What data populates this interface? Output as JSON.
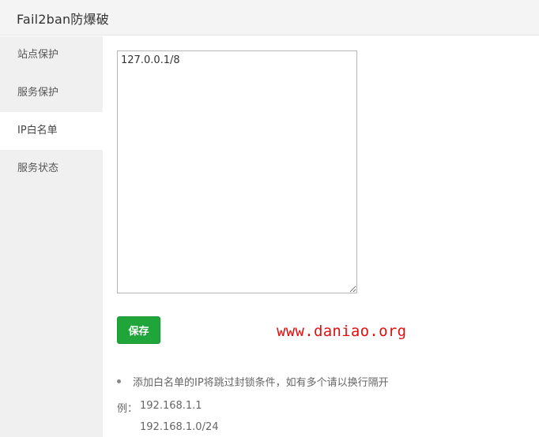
{
  "window": {
    "title": "Fail2ban防爆破"
  },
  "sidebar": {
    "items": [
      {
        "label": "站点保护",
        "active": false
      },
      {
        "label": "服务保护",
        "active": false
      },
      {
        "label": "IP白名单",
        "active": true
      },
      {
        "label": "服务状态",
        "active": false
      }
    ]
  },
  "main": {
    "whitelist_value": "127.0.0.1/8",
    "save_label": "保存",
    "watermark": "www.daniao.org",
    "tip": "添加白名单的IP将跳过封锁条件，如有多个请以换行隔开",
    "example_label": "例：",
    "example_1": "192.168.1.1",
    "example_2": "192.168.1.0/24"
  },
  "colors": {
    "accent": "#20a53a",
    "watermark": "#e01010",
    "sidebar_bg": "#f0f0f0",
    "titlebar_bg": "#f4f4f4"
  }
}
